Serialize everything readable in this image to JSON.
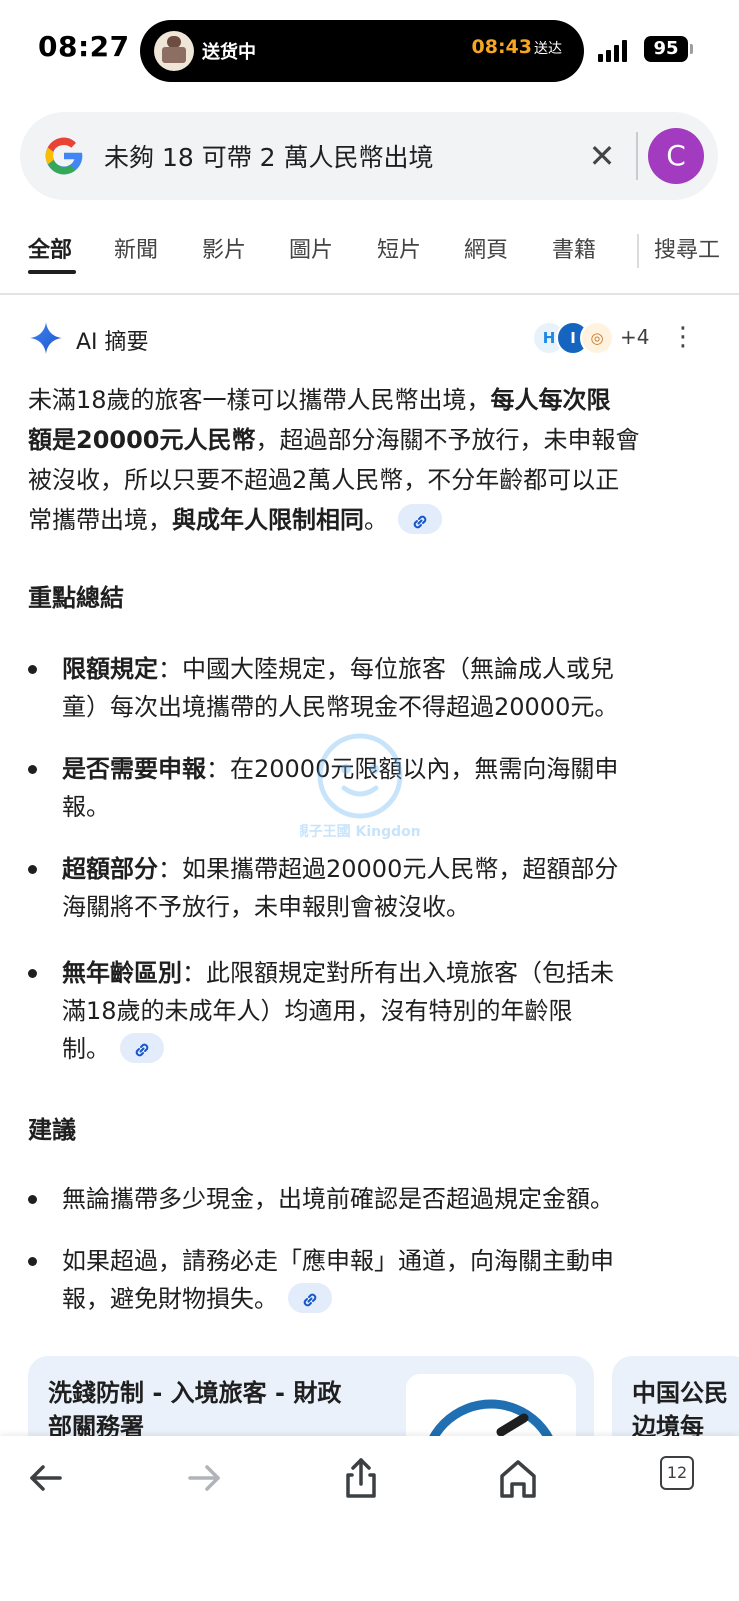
{
  "status_bar": {
    "time": "08:27",
    "island_text": "送货中",
    "island_eta_time": "08:43",
    "island_eta_label": "送达",
    "battery": "95"
  },
  "search": {
    "query": "未夠 18 可帶 2 萬人民幣出境",
    "avatar_letter": "C"
  },
  "tabs": [
    "全部",
    "新聞",
    "影片",
    "圖片",
    "短片",
    "網頁",
    "書籍",
    "搜尋工"
  ],
  "ai_overview": {
    "title": "AI 摘要",
    "sources": [
      "H",
      "I",
      "◎"
    ],
    "sources_more": "+4",
    "intro_lines": [
      [
        "未滿18歲的旅客一樣可以攜帶人民幣出境，",
        "每人每次限"
      ],
      [
        "額是20000元人民幣",
        "，超過部分海關不予放行，未申報會"
      ],
      [
        "被沒收，所以只要不超過2萬人民幣，不分年齡都可以正"
      ],
      [
        "常攜帶出境，",
        "與成年人限制相同",
        "。"
      ]
    ],
    "summary_title": "重點總結",
    "summary_items": [
      {
        "bold": "限額規定",
        "lines": [
          "：中國大陸規定，每位旅客（無論成人或兒",
          "童）每次出境攜帶的人民幣現金不得超過20000元。"
        ]
      },
      {
        "bold": "是否需要申報",
        "lines": [
          "：在20000元限額以內，無需向海關申",
          "報。"
        ]
      },
      {
        "bold": "超額部分",
        "lines": [
          "：如果攜帶超過20000元人民幣，超額部分",
          "海關將不予放行，未申報則會被沒收。"
        ]
      },
      {
        "bold": "無年齡區別",
        "lines": [
          "：此限額規定對所有出入境旅客（包括未",
          "滿18歲的未成年人）均適用，沒有特別的年齡限",
          "制。"
        ]
      }
    ],
    "advice_title": "建議",
    "advice_items": [
      {
        "lines": [
          "無論攜帶多少現金，出境前確認是否超過規定金額。"
        ]
      },
      {
        "lines": [
          "如果超過，請務必走「應申報」通道，向海關主動申",
          "報，避免財物損失。"
        ]
      }
    ]
  },
  "cards": [
    {
      "title_lines": [
        "洗錢防制 - 入境旅客 - 財政",
        "部關務署"
      ]
    },
    {
      "title_lines": [
        "中国公民",
        "边境每"
      ]
    }
  ],
  "watermark_text": "親子王國 Kingdom",
  "bottom_bar": {
    "tab_count": "12"
  },
  "colors": {
    "accent_blue": "#1a73e8",
    "avatar_purple": "#a23bbf",
    "chip_bg": "#e3ecfa",
    "card_bg": "#eaf1fb",
    "eta_orange": "#f5a623"
  }
}
